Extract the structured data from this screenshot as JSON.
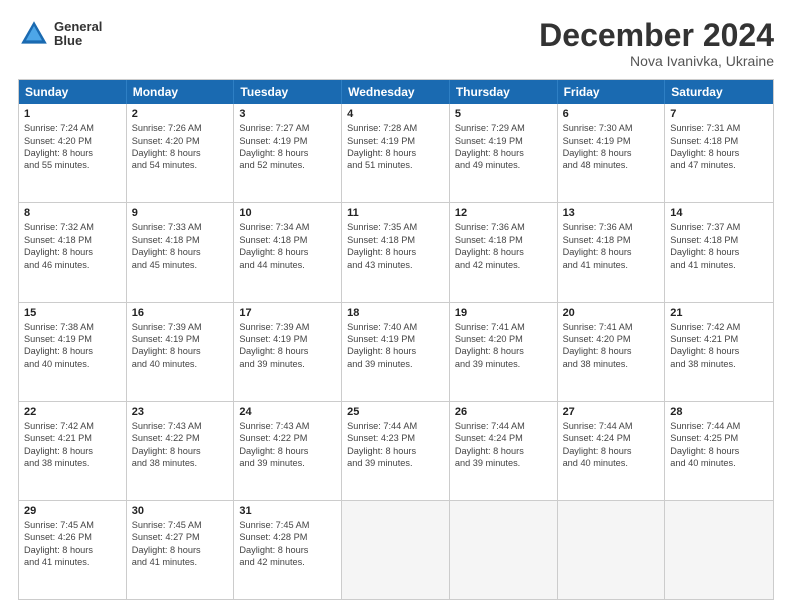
{
  "header": {
    "logo_line1": "General",
    "logo_line2": "Blue",
    "month": "December 2024",
    "location": "Nova Ivanivka, Ukraine"
  },
  "days_of_week": [
    "Sunday",
    "Monday",
    "Tuesday",
    "Wednesday",
    "Thursday",
    "Friday",
    "Saturday"
  ],
  "weeks": [
    [
      {
        "day": "1",
        "lines": [
          "Sunrise: 7:24 AM",
          "Sunset: 4:20 PM",
          "Daylight: 8 hours",
          "and 55 minutes."
        ]
      },
      {
        "day": "2",
        "lines": [
          "Sunrise: 7:26 AM",
          "Sunset: 4:20 PM",
          "Daylight: 8 hours",
          "and 54 minutes."
        ]
      },
      {
        "day": "3",
        "lines": [
          "Sunrise: 7:27 AM",
          "Sunset: 4:19 PM",
          "Daylight: 8 hours",
          "and 52 minutes."
        ]
      },
      {
        "day": "4",
        "lines": [
          "Sunrise: 7:28 AM",
          "Sunset: 4:19 PM",
          "Daylight: 8 hours",
          "and 51 minutes."
        ]
      },
      {
        "day": "5",
        "lines": [
          "Sunrise: 7:29 AM",
          "Sunset: 4:19 PM",
          "Daylight: 8 hours",
          "and 49 minutes."
        ]
      },
      {
        "day": "6",
        "lines": [
          "Sunrise: 7:30 AM",
          "Sunset: 4:19 PM",
          "Daylight: 8 hours",
          "and 48 minutes."
        ]
      },
      {
        "day": "7",
        "lines": [
          "Sunrise: 7:31 AM",
          "Sunset: 4:18 PM",
          "Daylight: 8 hours",
          "and 47 minutes."
        ]
      }
    ],
    [
      {
        "day": "8",
        "lines": [
          "Sunrise: 7:32 AM",
          "Sunset: 4:18 PM",
          "Daylight: 8 hours",
          "and 46 minutes."
        ]
      },
      {
        "day": "9",
        "lines": [
          "Sunrise: 7:33 AM",
          "Sunset: 4:18 PM",
          "Daylight: 8 hours",
          "and 45 minutes."
        ]
      },
      {
        "day": "10",
        "lines": [
          "Sunrise: 7:34 AM",
          "Sunset: 4:18 PM",
          "Daylight: 8 hours",
          "and 44 minutes."
        ]
      },
      {
        "day": "11",
        "lines": [
          "Sunrise: 7:35 AM",
          "Sunset: 4:18 PM",
          "Daylight: 8 hours",
          "and 43 minutes."
        ]
      },
      {
        "day": "12",
        "lines": [
          "Sunrise: 7:36 AM",
          "Sunset: 4:18 PM",
          "Daylight: 8 hours",
          "and 42 minutes."
        ]
      },
      {
        "day": "13",
        "lines": [
          "Sunrise: 7:36 AM",
          "Sunset: 4:18 PM",
          "Daylight: 8 hours",
          "and 41 minutes."
        ]
      },
      {
        "day": "14",
        "lines": [
          "Sunrise: 7:37 AM",
          "Sunset: 4:18 PM",
          "Daylight: 8 hours",
          "and 41 minutes."
        ]
      }
    ],
    [
      {
        "day": "15",
        "lines": [
          "Sunrise: 7:38 AM",
          "Sunset: 4:19 PM",
          "Daylight: 8 hours",
          "and 40 minutes."
        ]
      },
      {
        "day": "16",
        "lines": [
          "Sunrise: 7:39 AM",
          "Sunset: 4:19 PM",
          "Daylight: 8 hours",
          "and 40 minutes."
        ]
      },
      {
        "day": "17",
        "lines": [
          "Sunrise: 7:39 AM",
          "Sunset: 4:19 PM",
          "Daylight: 8 hours",
          "and 39 minutes."
        ]
      },
      {
        "day": "18",
        "lines": [
          "Sunrise: 7:40 AM",
          "Sunset: 4:19 PM",
          "Daylight: 8 hours",
          "and 39 minutes."
        ]
      },
      {
        "day": "19",
        "lines": [
          "Sunrise: 7:41 AM",
          "Sunset: 4:20 PM",
          "Daylight: 8 hours",
          "and 39 minutes."
        ]
      },
      {
        "day": "20",
        "lines": [
          "Sunrise: 7:41 AM",
          "Sunset: 4:20 PM",
          "Daylight: 8 hours",
          "and 38 minutes."
        ]
      },
      {
        "day": "21",
        "lines": [
          "Sunrise: 7:42 AM",
          "Sunset: 4:21 PM",
          "Daylight: 8 hours",
          "and 38 minutes."
        ]
      }
    ],
    [
      {
        "day": "22",
        "lines": [
          "Sunrise: 7:42 AM",
          "Sunset: 4:21 PM",
          "Daylight: 8 hours",
          "and 38 minutes."
        ]
      },
      {
        "day": "23",
        "lines": [
          "Sunrise: 7:43 AM",
          "Sunset: 4:22 PM",
          "Daylight: 8 hours",
          "and 38 minutes."
        ]
      },
      {
        "day": "24",
        "lines": [
          "Sunrise: 7:43 AM",
          "Sunset: 4:22 PM",
          "Daylight: 8 hours",
          "and 39 minutes."
        ]
      },
      {
        "day": "25",
        "lines": [
          "Sunrise: 7:44 AM",
          "Sunset: 4:23 PM",
          "Daylight: 8 hours",
          "and 39 minutes."
        ]
      },
      {
        "day": "26",
        "lines": [
          "Sunrise: 7:44 AM",
          "Sunset: 4:24 PM",
          "Daylight: 8 hours",
          "and 39 minutes."
        ]
      },
      {
        "day": "27",
        "lines": [
          "Sunrise: 7:44 AM",
          "Sunset: 4:24 PM",
          "Daylight: 8 hours",
          "and 40 minutes."
        ]
      },
      {
        "day": "28",
        "lines": [
          "Sunrise: 7:44 AM",
          "Sunset: 4:25 PM",
          "Daylight: 8 hours",
          "and 40 minutes."
        ]
      }
    ],
    [
      {
        "day": "29",
        "lines": [
          "Sunrise: 7:45 AM",
          "Sunset: 4:26 PM",
          "Daylight: 8 hours",
          "and 41 minutes."
        ]
      },
      {
        "day": "30",
        "lines": [
          "Sunrise: 7:45 AM",
          "Sunset: 4:27 PM",
          "Daylight: 8 hours",
          "and 41 minutes."
        ]
      },
      {
        "day": "31",
        "lines": [
          "Sunrise: 7:45 AM",
          "Sunset: 4:28 PM",
          "Daylight: 8 hours",
          "and 42 minutes."
        ]
      },
      {
        "day": "",
        "lines": []
      },
      {
        "day": "",
        "lines": []
      },
      {
        "day": "",
        "lines": []
      },
      {
        "day": "",
        "lines": []
      }
    ]
  ]
}
